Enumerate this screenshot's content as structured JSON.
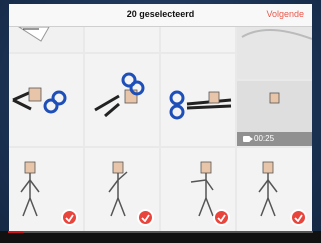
{
  "nav": {
    "title": "20 geselecteerd",
    "next_label": "Volgende",
    "accent_color": "#e8584c"
  },
  "grid": {
    "cells": [
      {
        "kind": "photo-partial",
        "selected": false
      },
      {
        "kind": "photo-partial",
        "selected": false
      },
      {
        "kind": "photo-partial",
        "selected": false
      },
      {
        "kind": "photo-partial",
        "selected": false
      },
      {
        "kind": "scissors",
        "selected": false
      },
      {
        "kind": "scissors",
        "selected": false
      },
      {
        "kind": "scissors",
        "selected": false
      },
      {
        "kind": "video",
        "selected": false,
        "duration": "00:25"
      },
      {
        "kind": "stick-figure",
        "selected": true
      },
      {
        "kind": "stick-figure",
        "selected": true
      },
      {
        "kind": "stick-figure",
        "selected": true
      },
      {
        "kind": "stick-figure",
        "selected": true
      }
    ],
    "check_color": "#e8453c"
  },
  "player": {
    "progress_fraction": 0.05
  }
}
